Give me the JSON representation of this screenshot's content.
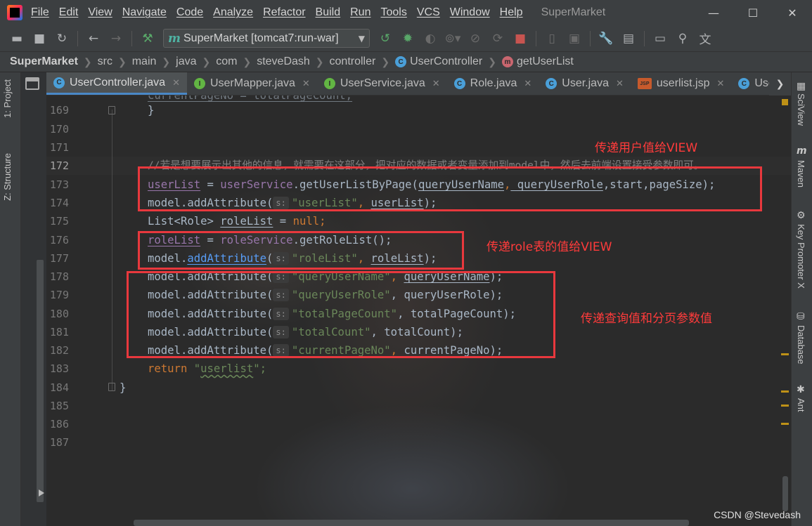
{
  "window": {
    "title": "SuperMarket",
    "menu": [
      "File",
      "Edit",
      "View",
      "Navigate",
      "Code",
      "Analyze",
      "Refactor",
      "Build",
      "Run",
      "Tools",
      "VCS",
      "Window",
      "Help"
    ],
    "controls": {
      "minimize": "—",
      "maximize": "☐",
      "close": "✕"
    }
  },
  "toolbar": {
    "run_config": "SuperMarket [tomcat7:run-war]",
    "run_config_icon": "m"
  },
  "breadcrumb": [
    "SuperMarket",
    "src",
    "main",
    "java",
    "com",
    "steveDash",
    "controller",
    "UserController",
    "getUserList"
  ],
  "tabs": [
    {
      "label": "UserController.java",
      "badge": "C",
      "color": "#4a9fd8",
      "active": true
    },
    {
      "label": "UserMapper.java",
      "badge": "I",
      "color": "#62b543",
      "active": false
    },
    {
      "label": "UserService.java",
      "badge": "I",
      "color": "#62b543",
      "active": false
    },
    {
      "label": "Role.java",
      "badge": "C",
      "color": "#4a9fd8",
      "active": false
    },
    {
      "label": "User.java",
      "badge": "C",
      "color": "#4a9fd8",
      "active": false
    },
    {
      "label": "userlist.jsp",
      "badge": "JSP",
      "color": "#c75a2c",
      "active": false
    },
    {
      "label": "Use",
      "badge": "C",
      "color": "#4a9fd8",
      "active": false
    }
  ],
  "left_tools": {
    "project": "1: Project",
    "structure": "Z: Structure"
  },
  "right_tools": {
    "sciview": "SciView",
    "maven": "Maven",
    "key_promoter": "Key Promoter X",
    "database": "Database",
    "ant": "Ant"
  },
  "line_numbers": [
    "169",
    "170",
    "171",
    "172",
    "173",
    "174",
    "175",
    "176",
    "177",
    "178",
    "179",
    "180",
    "181",
    "182",
    "183",
    "184",
    "185",
    "186",
    "187"
  ],
  "current_line": "172",
  "code": {
    "top_partial": "currentPageNo = totalPageCount;",
    "l169": "}",
    "l172": "//若是想要展示出其他的信息，就需要在这部分，把对应的数据或者变量添加到model中，然后去前端设置接受参数即可。",
    "l173": {
      "a": "userList",
      "b": " = ",
      "c": "userService",
      "d": ".getUserListByPage(",
      "e": "queryUserName",
      "f": ",",
      "g": "_queryUserRole",
      "h": ",start,pageSize);"
    },
    "l174": {
      "a": "model.addAttribute(",
      "hint": "s:",
      "str": "\"userList\"",
      "b": ", ",
      "c": "userList",
      "d": ");"
    },
    "l175": {
      "a": "List<Role> ",
      "b": "roleList",
      "c": " = ",
      "d": "null",
      "e": ";"
    },
    "l176": {
      "a": "roleList",
      "b": " = ",
      "c": "roleService",
      "d": ".getRoleList();"
    },
    "l177": {
      "a": "model.",
      "b": "addAttribute",
      "c": "(",
      "hint": "s:",
      "str": "\"roleList\"",
      "d": ", ",
      "e": "roleList",
      "f": ");"
    },
    "l178": {
      "a": "model.addAttribute(",
      "hint": "s:",
      "str": "\"queryUserName\"",
      "b": ", ",
      "c": "queryUserName",
      "d": ");"
    },
    "l179": {
      "a": "model.addAttribute(",
      "hint": "s:",
      "str": "\"queryUserRole\"",
      "b": ", queryUserRole);"
    },
    "l180": {
      "a": "model.addAttribute(",
      "hint": "s:",
      "str": "\"totalPageCount\"",
      "b": ", totalPageCount);"
    },
    "l181": {
      "a": "model.addAttribute(",
      "hint": "s:",
      "str": "\"totalCount\"",
      "b": ", totalCount);"
    },
    "l182": {
      "a": "model.addAttribute(",
      "hint": "s:",
      "str": "\"currentPageNo\"",
      "b": ", ",
      "c": "currentPageNo",
      "d": ");"
    },
    "l183": {
      "a": "return ",
      "b": "\"",
      "c": "userlist",
      "d": "\";"
    },
    "l184": "}"
  },
  "annotations": {
    "user_to_view": "传递用户值给VIEW",
    "role_to_view": "传递role表的值给VIEW",
    "query_paging": "传递查询值和分页参数值"
  },
  "watermark": "CSDN @Stevedash",
  "colors": {
    "keyword": "#cc7832",
    "field": "#9876aa",
    "string": "#6a8759",
    "comment": "#808080",
    "annotation": "#e8383d"
  }
}
